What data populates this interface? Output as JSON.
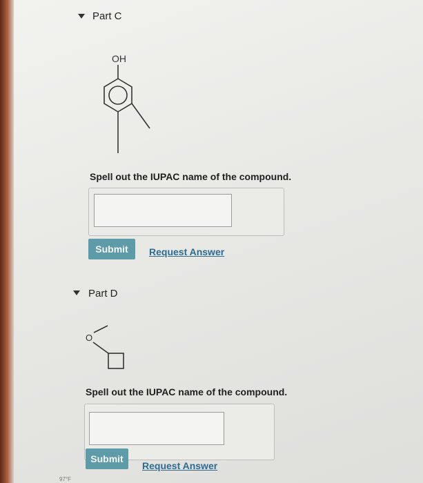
{
  "part_c": {
    "title": "Part C",
    "hydroxyl_label": "OH",
    "question": "Spell out the IUPAC name of the compound.",
    "answer_value": "",
    "submit_label": "Submit",
    "request_label": "Request Answer"
  },
  "part_d": {
    "title": "Part D",
    "oxygen_label": "O",
    "question": "Spell out the IUPAC name of the compound.",
    "answer_value": "",
    "submit_label": "Submit",
    "request_label": "Request Answer"
  },
  "status": {
    "partial_text": "97°F"
  },
  "colors": {
    "submit_bg": "#5f9aa8",
    "link": "#2f6a91"
  }
}
